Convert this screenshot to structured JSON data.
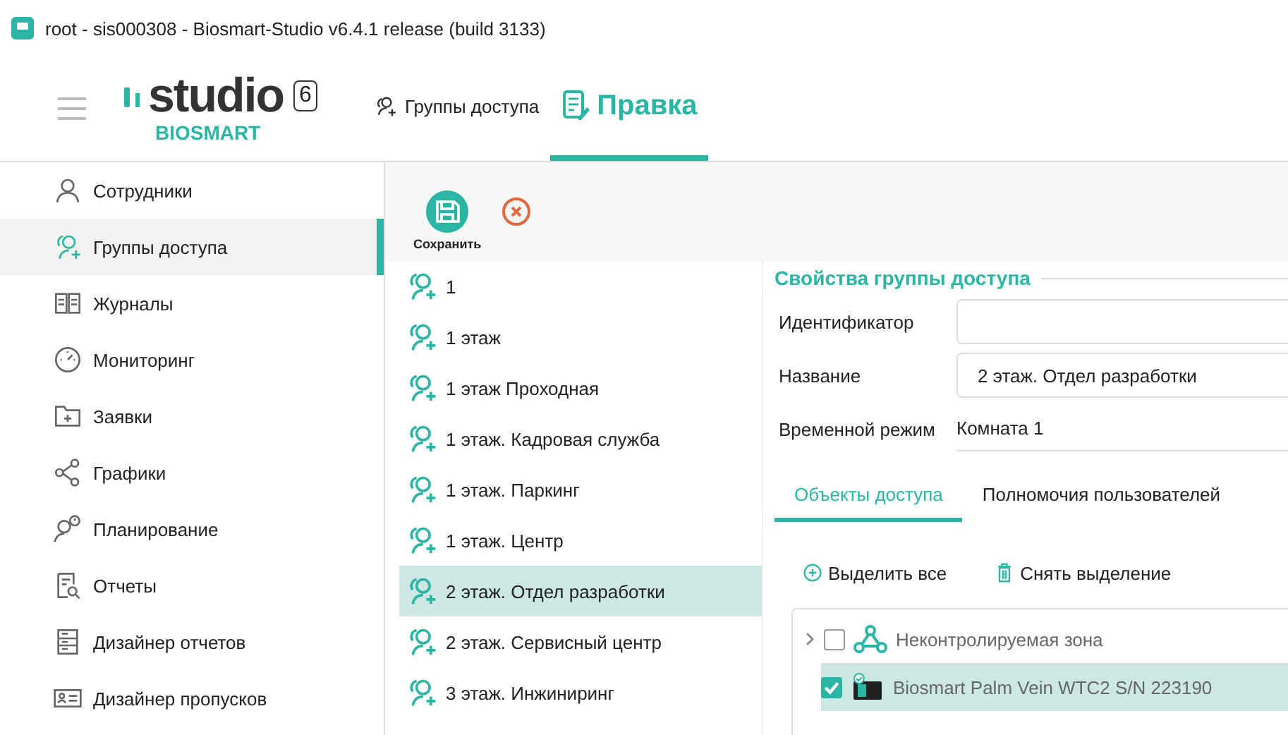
{
  "window": {
    "title": "root - sis000308 - Biosmart-Studio v6.4.1 release (build 3133)"
  },
  "logo": {
    "wordmark": "studio",
    "version": "6",
    "brand": "BIOSMART"
  },
  "header_tabs": [
    {
      "label": "Группы доступа",
      "selected": false
    },
    {
      "label": "Правка",
      "selected": true
    }
  ],
  "sidebar": {
    "items": [
      {
        "label": "Сотрудники",
        "kind": "person",
        "selected": false
      },
      {
        "label": "Группы доступа",
        "kind": "group",
        "selected": true
      },
      {
        "label": "Журналы",
        "kind": "book",
        "selected": false
      },
      {
        "label": "Мониторинг",
        "kind": "gauge",
        "selected": false
      },
      {
        "label": "Заявки",
        "kind": "folder",
        "selected": false
      },
      {
        "label": "Графики",
        "kind": "share",
        "selected": false
      },
      {
        "label": "Планирование",
        "kind": "clock",
        "selected": false
      },
      {
        "label": "Отчеты",
        "kind": "report",
        "selected": false
      },
      {
        "label": "Дизайнер отчетов",
        "kind": "cabinet",
        "selected": false
      },
      {
        "label": "Дизайнер пропусков",
        "kind": "card",
        "selected": false
      }
    ]
  },
  "toolbar": {
    "buttons": [
      {
        "kind": "save",
        "label": "Сохранить"
      },
      {
        "kind": "cancel"
      }
    ]
  },
  "groups": [
    {
      "label": "1",
      "selected": false
    },
    {
      "label": "1 этаж",
      "selected": false
    },
    {
      "label": "1 этаж Проходная",
      "selected": false
    },
    {
      "label": "1 этаж. Кадровая служба",
      "selected": false
    },
    {
      "label": "1 этаж. Паркинг",
      "selected": false
    },
    {
      "label": "1 этаж. Центр",
      "selected": false
    },
    {
      "label": "2 этаж. Отдел разработки",
      "selected": true
    },
    {
      "label": "2 этаж. Сервисный центр",
      "selected": false
    },
    {
      "label": "3 этаж. Инжиниринг",
      "selected": false
    }
  ],
  "properties": {
    "title": "Свойства группы доступа",
    "fields": [
      {
        "label": "Идентификатор",
        "kind": "input"
      },
      {
        "label": "Название",
        "kind": "input",
        "value": "2 этаж. Отдел разработки"
      },
      {
        "label": "Временной режим",
        "kind": "select",
        "value": "Комната 1"
      }
    ]
  },
  "tabs": [
    {
      "label": "Объекты доступа",
      "selected": true
    },
    {
      "label": "Полномочия пользователей",
      "selected": false
    }
  ],
  "actions": [
    {
      "kind": "add",
      "label": "Выделить все"
    },
    {
      "kind": "delete",
      "label": "Снять выделение"
    }
  ],
  "tree": [
    {
      "label": "Неконтролируемая зона",
      "kind": "zone",
      "expanded": false,
      "checked": false,
      "selected": false
    },
    {
      "label": "Biosmart Palm Vein WTC2 S/N 223190",
      "kind": "device",
      "checked": true,
      "selected": true
    }
  ]
}
